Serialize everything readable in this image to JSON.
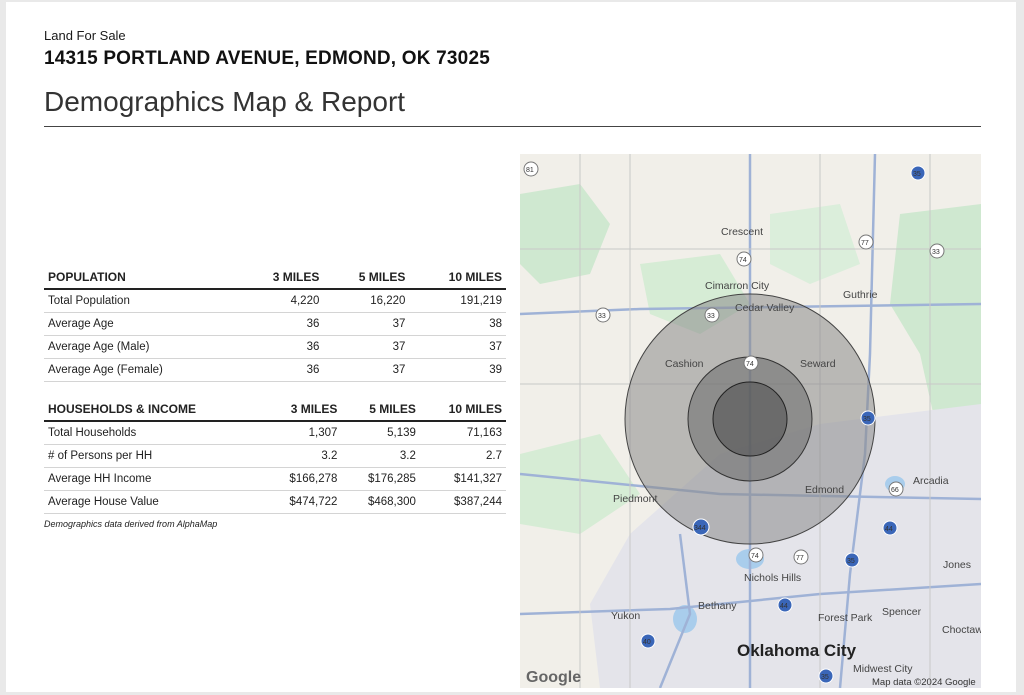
{
  "header": {
    "eyebrow": "Land For Sale",
    "address": "14315 PORTLAND AVENUE, EDMOND, OK 73025",
    "title": "Demographics Map & Report"
  },
  "population": {
    "headers": [
      "POPULATION",
      "3 MILES",
      "5 MILES",
      "10 MILES"
    ],
    "rows": [
      [
        "Total Population",
        "4,220",
        "16,220",
        "191,219"
      ],
      [
        "Average Age",
        "36",
        "37",
        "38"
      ],
      [
        "Average Age (Male)",
        "36",
        "37",
        "37"
      ],
      [
        "Average Age (Female)",
        "36",
        "37",
        "39"
      ]
    ]
  },
  "households": {
    "headers": [
      "HOUSEHOLDS & INCOME",
      "3 MILES",
      "5 MILES",
      "10 MILES"
    ],
    "rows": [
      [
        "Total Households",
        "1,307",
        "5,139",
        "71,163"
      ],
      [
        "# of Persons per HH",
        "3.2",
        "3.2",
        "2.7"
      ],
      [
        "Average HH Income",
        "$166,278",
        "$176,285",
        "$141,327"
      ],
      [
        "Average House Value",
        "$474,722",
        "$468,300",
        "$387,244"
      ]
    ]
  },
  "note": "Demographics data derived from AlphaMap",
  "map": {
    "places": [
      "Crescent",
      "Cimarron City",
      "Cedar Valley",
      "Guthrie",
      "Cashion",
      "Seward",
      "Piedmont",
      "Edmond",
      "Arcadia",
      "Jones",
      "Nichols Hills",
      "Bethany",
      "Yukon",
      "Forest Park",
      "Spencer",
      "Choctaw",
      "Oklahoma City",
      "Midwest City"
    ],
    "route_shields": [
      "81",
      "35",
      "77",
      "33",
      "74",
      "33",
      "33",
      "74",
      "35",
      "66",
      "44",
      "344",
      "74",
      "77",
      "35",
      "44",
      "40",
      "35"
    ],
    "logo": "Google",
    "attribution": "Map data ©2024 Google",
    "ring_colors": {
      "outer": "#8a8a8a",
      "middle": "#6a6a6a",
      "inner": "#4a4a4a"
    }
  }
}
